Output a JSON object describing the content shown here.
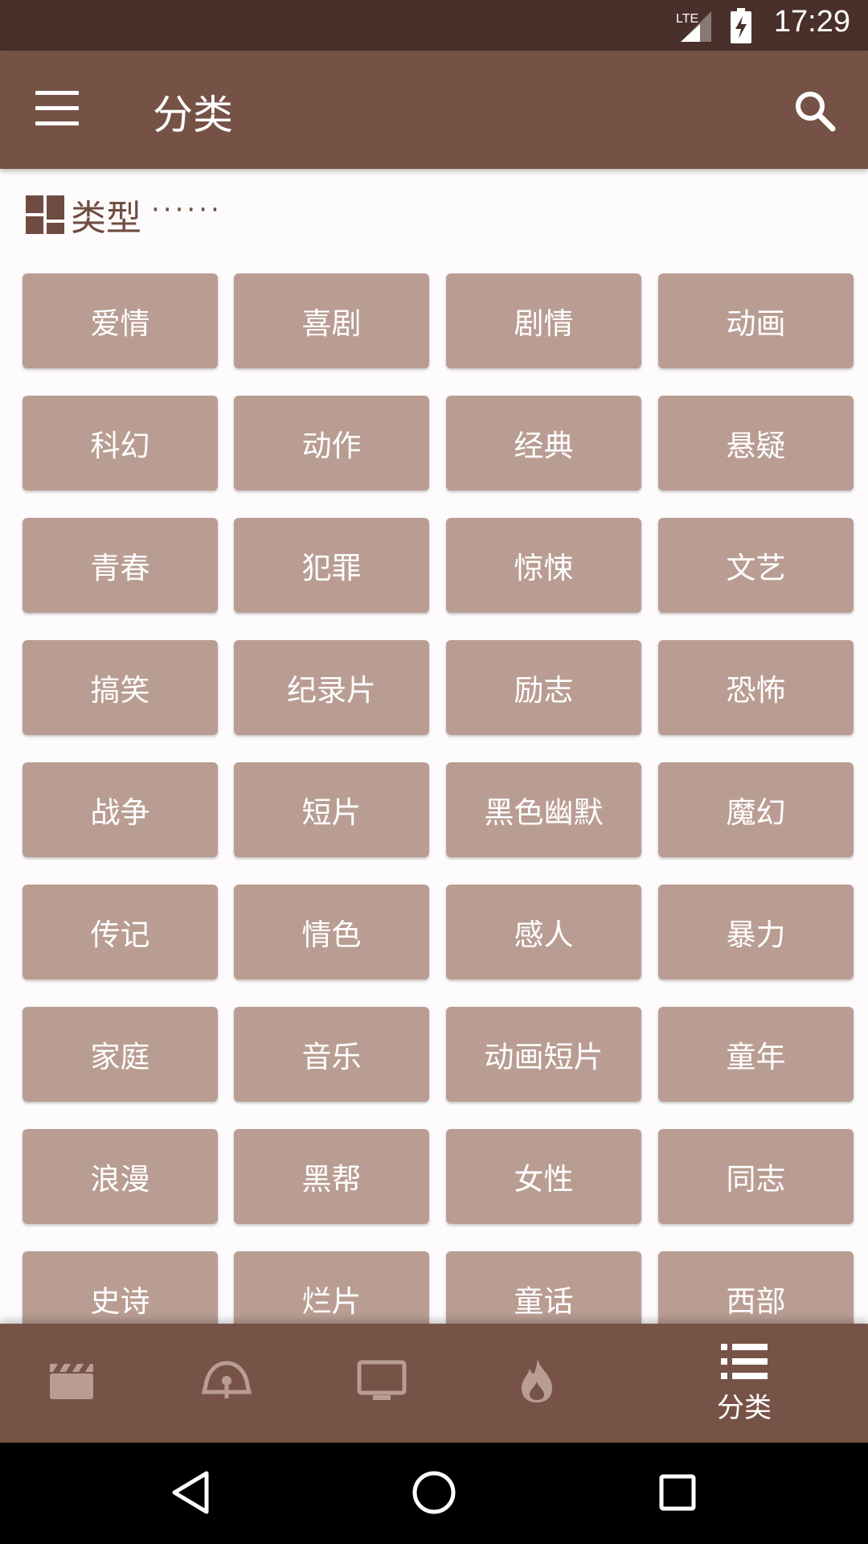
{
  "status_bar": {
    "time": "17:29",
    "network_label": "LTE",
    "icons": [
      "signal-icon",
      "battery-charging-icon"
    ]
  },
  "app_bar": {
    "title": "分类",
    "menu_icon": "menu-icon",
    "search_icon": "search-icon"
  },
  "section": {
    "icon": "grid-icon",
    "title": "类型",
    "dots": "······"
  },
  "tags": [
    [
      "爱情",
      "喜剧",
      "剧情",
      "动画"
    ],
    [
      "科幻",
      "动作",
      "经典",
      "悬疑"
    ],
    [
      "青春",
      "犯罪",
      "惊悚",
      "文艺"
    ],
    [
      "搞笑",
      "纪录片",
      "励志",
      "恐怖"
    ],
    [
      "战争",
      "短片",
      "黑色幽默",
      "魔幻"
    ],
    [
      "传记",
      "情色",
      "感人",
      "暴力"
    ],
    [
      "家庭",
      "音乐",
      "动画短片",
      "童年"
    ],
    [
      "浪漫",
      "黑帮",
      "女性",
      "同志"
    ],
    [
      "史诗",
      "烂片",
      "童话",
      "西部"
    ]
  ],
  "bottom_nav": {
    "items": [
      {
        "icon": "clapperboard-icon",
        "label": ""
      },
      {
        "icon": "bell-icon",
        "label": ""
      },
      {
        "icon": "tv-icon",
        "label": ""
      },
      {
        "icon": "flame-icon",
        "label": ""
      },
      {
        "icon": "list-icon",
        "label": "分类",
        "active": true
      }
    ]
  },
  "system_nav": {
    "icons": [
      "back-icon",
      "home-icon",
      "recents-icon"
    ]
  },
  "colors": {
    "app_bar": "#765246",
    "status_bar": "#4a302a",
    "tag": "#b99d93",
    "accent_text": "#6f4c42"
  }
}
